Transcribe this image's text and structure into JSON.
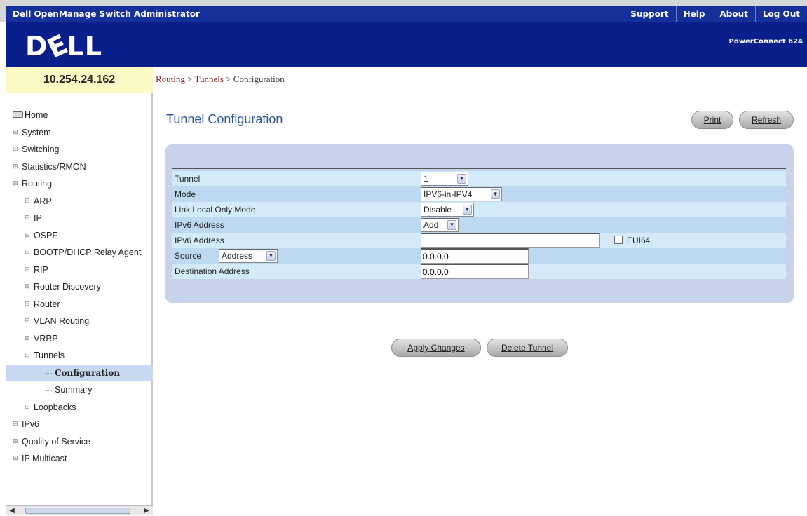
{
  "header": {
    "app_title": "Dell OpenManage Switch Administrator",
    "links": [
      "Support",
      "Help",
      "About",
      "Log Out"
    ],
    "product": "PowerConnect 624"
  },
  "logo": {
    "text_d": "D",
    "text_e": "E",
    "text_ll": "LL"
  },
  "sidebar": {
    "ip": "10.254.24.162",
    "nav": {
      "home": "Home",
      "system": "System",
      "switching": "Switching",
      "statistics": "Statistics/RMON",
      "routing": "Routing",
      "arp": "ARP",
      "ip": "IP",
      "ospf": "OSPF",
      "bootp": "BOOTP/DHCP Relay Agent",
      "rip": "RIP",
      "router_discovery": "Router Discovery",
      "router": "Router",
      "vlan_routing": "VLAN Routing",
      "vrrp": "VRRP",
      "tunnels": "Tunnels",
      "configuration": "Configuration",
      "summary": "Summary",
      "loopbacks": "Loopbacks",
      "ipv6": "IPv6",
      "qos": "Quality of Service",
      "ip_multicast": "IP Multicast"
    },
    "expand_symbol": "⊞",
    "collapse_symbol": "⊟"
  },
  "breadcrumb": {
    "routing": "Routing",
    "tunnels": "Tunnels",
    "current": "Configuration",
    "sep": ">"
  },
  "page": {
    "title": "Tunnel Configuration",
    "print": "Print",
    "refresh": "Refresh",
    "apply": "Apply Changes",
    "delete": "Delete Tunnel"
  },
  "form": {
    "tunnel_label": "Tunnel",
    "tunnel_value": "1",
    "mode_label": "Mode",
    "mode_value": "IPV6-in-IPV4",
    "link_local_label": "Link Local Only Mode",
    "link_local_value": "Disable",
    "ipv6_action_label": "IPv6 Address",
    "ipv6_action_value": "Add",
    "ipv6_addr_label": "IPv6 Address",
    "ipv6_addr_value": "",
    "eui64_label": "EUI64",
    "source_label": "Source",
    "source_type_value": "Address",
    "source_value": "0.0.0.0",
    "dest_label": "Destination Address",
    "dest_value": "0.0.0.0"
  }
}
